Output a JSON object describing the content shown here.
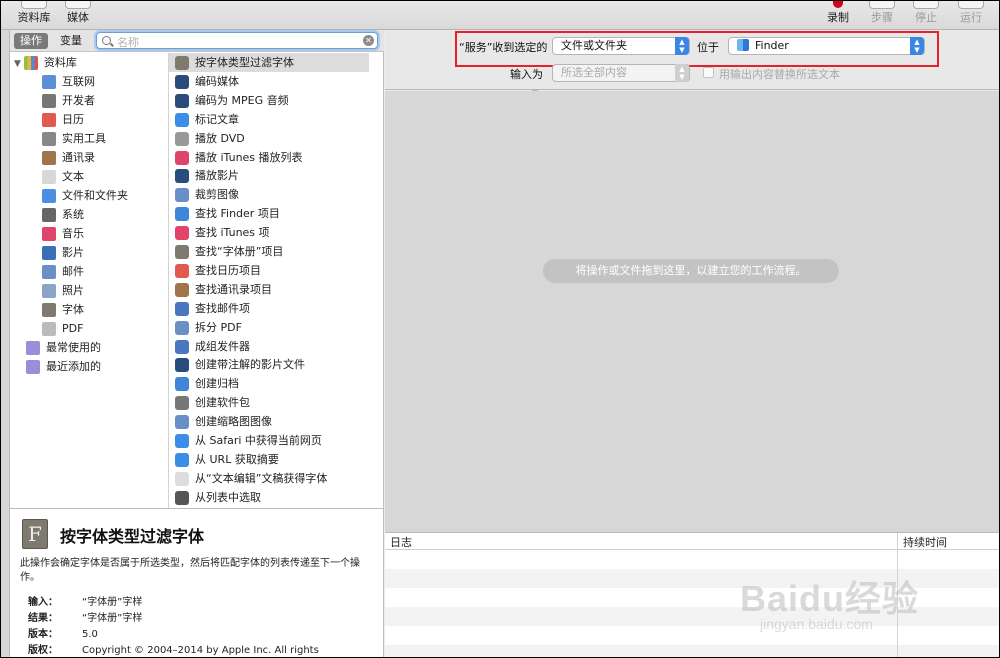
{
  "toolbar": {
    "left": [
      {
        "label": "资料库",
        "icon": "library-icon"
      },
      {
        "label": "媒体",
        "icon": "media-icon"
      }
    ],
    "right": [
      {
        "label": "录制",
        "icon": "record-icon",
        "enabled": true
      },
      {
        "label": "步骤",
        "icon": "step-icon",
        "enabled": false
      },
      {
        "label": "停止",
        "icon": "stop-icon",
        "enabled": false
      },
      {
        "label": "运行",
        "icon": "run-icon",
        "enabled": false
      }
    ]
  },
  "library": {
    "tabs": [
      "操作",
      "变量"
    ],
    "search_placeholder": "名称",
    "root": "资料库",
    "categories": [
      {
        "label": "互联网",
        "icon": "globe-icon"
      },
      {
        "label": "开发者",
        "icon": "developer-tools-icon"
      },
      {
        "label": "日历",
        "icon": "calendar-icon"
      },
      {
        "label": "实用工具",
        "icon": "utilities-icon"
      },
      {
        "label": "通讯录",
        "icon": "contacts-icon"
      },
      {
        "label": "文本",
        "icon": "text-icon"
      },
      {
        "label": "文件和文件夹",
        "icon": "finder-icon"
      },
      {
        "label": "系统",
        "icon": "system-icon"
      },
      {
        "label": "音乐",
        "icon": "music-icon"
      },
      {
        "label": "影片",
        "icon": "movie-icon"
      },
      {
        "label": "邮件",
        "icon": "mail-icon"
      },
      {
        "label": "照片",
        "icon": "photo-icon"
      },
      {
        "label": "字体",
        "icon": "font-icon"
      },
      {
        "label": "PDF",
        "icon": "pdf-icon"
      }
    ],
    "smart_groups": [
      {
        "label": "最常使用的",
        "icon": "smart-folder-icon"
      },
      {
        "label": "最近添加的",
        "icon": "smart-folder-icon"
      }
    ],
    "actions": [
      {
        "label": "按字体类型过滤字体",
        "icon": "font-book-icon"
      },
      {
        "label": "编码媒体",
        "icon": "quicktime-icon"
      },
      {
        "label": "编码为 MPEG 音频",
        "icon": "quicktime-icon"
      },
      {
        "label": "标记文章",
        "icon": "safari-icon"
      },
      {
        "label": "播放 DVD",
        "icon": "dvd-icon"
      },
      {
        "label": "播放 iTunes 播放列表",
        "icon": "itunes-icon"
      },
      {
        "label": "播放影片",
        "icon": "quicktime-icon"
      },
      {
        "label": "裁剪图像",
        "icon": "preview-icon"
      },
      {
        "label": "查找 Finder 项目",
        "icon": "finder-icon"
      },
      {
        "label": "查找 iTunes 项",
        "icon": "itunes-icon"
      },
      {
        "label": "查找“字体册”项目",
        "icon": "font-book-icon"
      },
      {
        "label": "查找日历项目",
        "icon": "calendar-icon"
      },
      {
        "label": "查找通讯录项目",
        "icon": "contacts-icon"
      },
      {
        "label": "查找邮件项",
        "icon": "mail-icon"
      },
      {
        "label": "拆分 PDF",
        "icon": "preview-icon"
      },
      {
        "label": "成组发件器",
        "icon": "mail-icon"
      },
      {
        "label": "创建带注解的影片文件",
        "icon": "quicktime-icon"
      },
      {
        "label": "创建归档",
        "icon": "finder-icon"
      },
      {
        "label": "创建软件包",
        "icon": "developer-tools-icon"
      },
      {
        "label": "创建缩略图图像",
        "icon": "preview-icon"
      },
      {
        "label": "从 Safari 中获得当前网页",
        "icon": "safari-icon"
      },
      {
        "label": "从 URL 获取摘要",
        "icon": "safari-icon"
      },
      {
        "label": "从“文本编辑”文稿获得字体",
        "icon": "textedit-icon"
      },
      {
        "label": "从列表中选取",
        "icon": "automator-icon"
      }
    ]
  },
  "description": {
    "icon_letter": "F",
    "title": "按字体类型过滤字体",
    "text": "此操作会确定字体是否属于所选类型，然后将匹配字体的列表传递至下一个操作。",
    "meta": [
      {
        "key": "输入：",
        "value": "“字体册”字样"
      },
      {
        "key": "结果：",
        "value": "“字体册”字样"
      },
      {
        "key": "版本：",
        "value": "5.0"
      },
      {
        "key": "版权：",
        "value": "Copyright © 2004–2014 by Apple Inc. All rights"
      }
    ]
  },
  "workflow": {
    "receives_label": "“服务”收到选定的",
    "receives_value": "文件或文件夹",
    "in_label": "位于",
    "in_value": "Finder",
    "input_label": "输入为",
    "input_value": "所选全部内容",
    "replace_label": "用输出内容替换所选文本",
    "hint": "将操作或文件拖到这里，以建立您的工作流程。"
  },
  "log": {
    "col_log": "日志",
    "col_duration": "持续时间"
  },
  "watermark": {
    "big": "Baidu经验",
    "small": "jingyan.baidu.com"
  },
  "colors": {
    "highlight_box": "#e8202a",
    "accent": "#3a86e8",
    "record": "#d0021b"
  }
}
